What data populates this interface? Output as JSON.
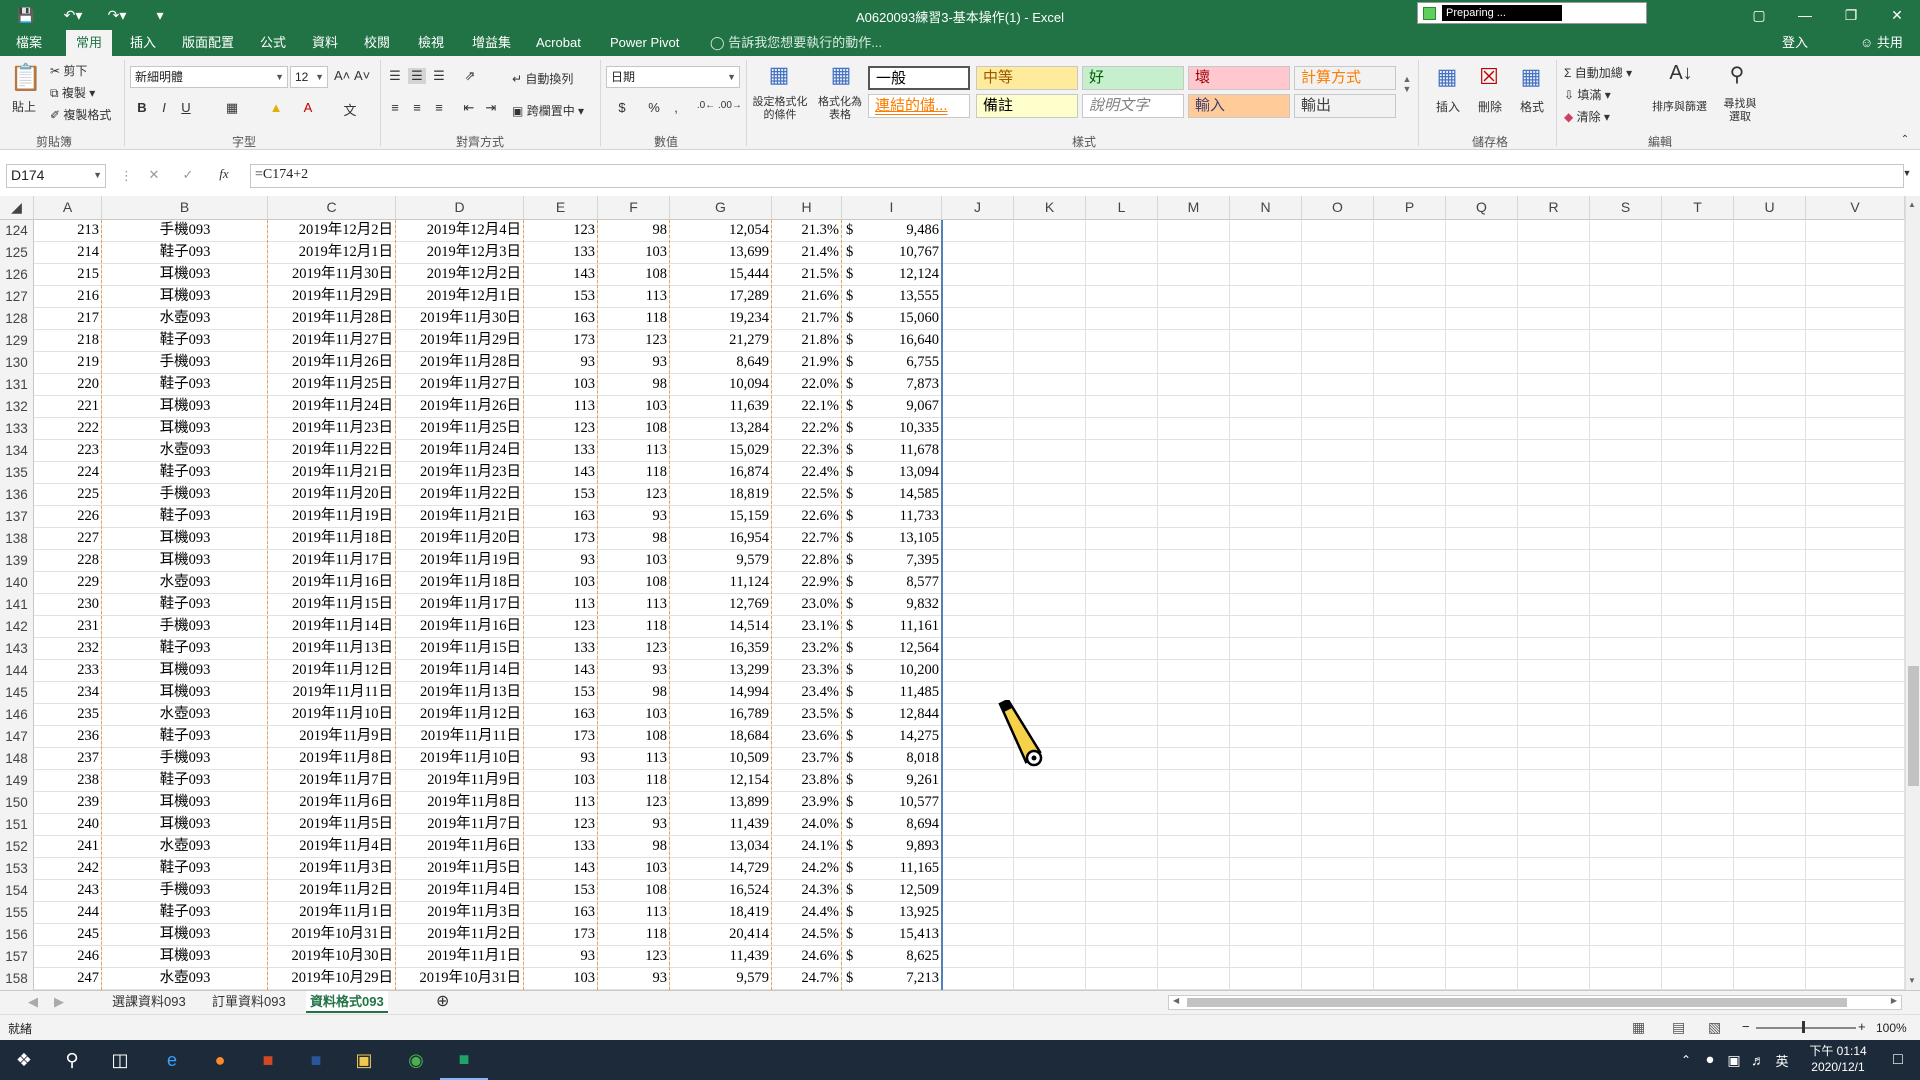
{
  "window": {
    "title": "A0620093練習3-基本操作(1) - Excel",
    "preparing_text": "Preparing ...",
    "signin": "登入",
    "share": "共用"
  },
  "menu": {
    "tabs": [
      "檔案",
      "常用",
      "插入",
      "版面配置",
      "公式",
      "資料",
      "校閱",
      "檢視",
      "增益集",
      "Acrobat",
      "Power Pivot"
    ],
    "active_index": 1,
    "tellme": "告訴我您想要執行的動作..."
  },
  "ribbon": {
    "clipboard": {
      "paste": "貼上",
      "cut": "剪下",
      "copy": "複製",
      "format_painter": "複製格式",
      "label": "剪貼簿"
    },
    "font": {
      "name": "新細明體",
      "size": "12",
      "label": "字型",
      "bold": "B",
      "italic": "I",
      "underline": "U"
    },
    "alignment": {
      "wrap": "自動換列",
      "merge": "跨欄置中",
      "label": "對齊方式"
    },
    "number": {
      "format": "日期",
      "currency": "$",
      "percent": "%",
      "comma": ",",
      "label": "數值"
    },
    "styles": {
      "conditional": "設定格式化的條件",
      "as_table": "格式化為表格",
      "cells": [
        {
          "text": "一般",
          "bg": "#ffffff",
          "fg": "#000000"
        },
        {
          "text": "中等",
          "bg": "#ffeb9c",
          "fg": "#9c5700"
        },
        {
          "text": "好",
          "bg": "#c6efce",
          "fg": "#006100"
        },
        {
          "text": "壞",
          "bg": "#ffc7ce",
          "fg": "#9c0006"
        },
        {
          "text": "計算方式",
          "bg": "#f2f2f2",
          "fg": "#fa7d00"
        },
        {
          "text": "連結的儲...",
          "bg": "#ffffff",
          "fg": "#fa7d00"
        },
        {
          "text": "備註",
          "bg": "#ffffcc",
          "fg": "#000000"
        },
        {
          "text": "說明文字",
          "bg": "#ffffff",
          "fg": "#7f7f7f"
        },
        {
          "text": "輸入",
          "bg": "#ffcc99",
          "fg": "#3f3f76"
        },
        {
          "text": "輸出",
          "bg": "#f2f2f2",
          "fg": "#3f3f3f"
        }
      ],
      "label": "樣式"
    },
    "cells_grp": {
      "insert": "插入",
      "delete": "刪除",
      "format": "格式",
      "label": "儲存格"
    },
    "editing": {
      "autosum": "自動加總",
      "fill": "填滿",
      "clear": "清除",
      "sort": "排序與篩選",
      "find": "尋找與選取",
      "label": "編輯"
    }
  },
  "formula_bar": {
    "name_box": "D174",
    "formula": "=C174+2",
    "fx": "fx"
  },
  "columns": [
    "A",
    "B",
    "C",
    "D",
    "E",
    "F",
    "G",
    "H",
    "I",
    "J",
    "K",
    "L",
    "M",
    "N",
    "O",
    "P",
    "Q",
    "R",
    "S",
    "T",
    "U",
    "V"
  ],
  "rows": [
    {
      "n": "124",
      "a": "213",
      "b": "手機093",
      "c": "2019年12月2日",
      "d": "2019年12月4日",
      "e": "123",
      "f": "98",
      "g": "12,054",
      "h": "21.3%",
      "i": "9,486"
    },
    {
      "n": "125",
      "a": "214",
      "b": "鞋子093",
      "c": "2019年12月1日",
      "d": "2019年12月3日",
      "e": "133",
      "f": "103",
      "g": "13,699",
      "h": "21.4%",
      "i": "10,767"
    },
    {
      "n": "126",
      "a": "215",
      "b": "耳機093",
      "c": "2019年11月30日",
      "d": "2019年12月2日",
      "e": "143",
      "f": "108",
      "g": "15,444",
      "h": "21.5%",
      "i": "12,124"
    },
    {
      "n": "127",
      "a": "216",
      "b": "耳機093",
      "c": "2019年11月29日",
      "d": "2019年12月1日",
      "e": "153",
      "f": "113",
      "g": "17,289",
      "h": "21.6%",
      "i": "13,555"
    },
    {
      "n": "128",
      "a": "217",
      "b": "水壺093",
      "c": "2019年11月28日",
      "d": "2019年11月30日",
      "e": "163",
      "f": "118",
      "g": "19,234",
      "h": "21.7%",
      "i": "15,060"
    },
    {
      "n": "129",
      "a": "218",
      "b": "鞋子093",
      "c": "2019年11月27日",
      "d": "2019年11月29日",
      "e": "173",
      "f": "123",
      "g": "21,279",
      "h": "21.8%",
      "i": "16,640"
    },
    {
      "n": "130",
      "a": "219",
      "b": "手機093",
      "c": "2019年11月26日",
      "d": "2019年11月28日",
      "e": "93",
      "f": "93",
      "g": "8,649",
      "h": "21.9%",
      "i": "6,755"
    },
    {
      "n": "131",
      "a": "220",
      "b": "鞋子093",
      "c": "2019年11月25日",
      "d": "2019年11月27日",
      "e": "103",
      "f": "98",
      "g": "10,094",
      "h": "22.0%",
      "i": "7,873"
    },
    {
      "n": "132",
      "a": "221",
      "b": "耳機093",
      "c": "2019年11月24日",
      "d": "2019年11月26日",
      "e": "113",
      "f": "103",
      "g": "11,639",
      "h": "22.1%",
      "i": "9,067"
    },
    {
      "n": "133",
      "a": "222",
      "b": "耳機093",
      "c": "2019年11月23日",
      "d": "2019年11月25日",
      "e": "123",
      "f": "108",
      "g": "13,284",
      "h": "22.2%",
      "i": "10,335"
    },
    {
      "n": "134",
      "a": "223",
      "b": "水壺093",
      "c": "2019年11月22日",
      "d": "2019年11月24日",
      "e": "133",
      "f": "113",
      "g": "15,029",
      "h": "22.3%",
      "i": "11,678"
    },
    {
      "n": "135",
      "a": "224",
      "b": "鞋子093",
      "c": "2019年11月21日",
      "d": "2019年11月23日",
      "e": "143",
      "f": "118",
      "g": "16,874",
      "h": "22.4%",
      "i": "13,094"
    },
    {
      "n": "136",
      "a": "225",
      "b": "手機093",
      "c": "2019年11月20日",
      "d": "2019年11月22日",
      "e": "153",
      "f": "123",
      "g": "18,819",
      "h": "22.5%",
      "i": "14,585"
    },
    {
      "n": "137",
      "a": "226",
      "b": "鞋子093",
      "c": "2019年11月19日",
      "d": "2019年11月21日",
      "e": "163",
      "f": "93",
      "g": "15,159",
      "h": "22.6%",
      "i": "11,733"
    },
    {
      "n": "138",
      "a": "227",
      "b": "耳機093",
      "c": "2019年11月18日",
      "d": "2019年11月20日",
      "e": "173",
      "f": "98",
      "g": "16,954",
      "h": "22.7%",
      "i": "13,105"
    },
    {
      "n": "139",
      "a": "228",
      "b": "耳機093",
      "c": "2019年11月17日",
      "d": "2019年11月19日",
      "e": "93",
      "f": "103",
      "g": "9,579",
      "h": "22.8%",
      "i": "7,395"
    },
    {
      "n": "140",
      "a": "229",
      "b": "水壺093",
      "c": "2019年11月16日",
      "d": "2019年11月18日",
      "e": "103",
      "f": "108",
      "g": "11,124",
      "h": "22.9%",
      "i": "8,577"
    },
    {
      "n": "141",
      "a": "230",
      "b": "鞋子093",
      "c": "2019年11月15日",
      "d": "2019年11月17日",
      "e": "113",
      "f": "113",
      "g": "12,769",
      "h": "23.0%",
      "i": "9,832"
    },
    {
      "n": "142",
      "a": "231",
      "b": "手機093",
      "c": "2019年11月14日",
      "d": "2019年11月16日",
      "e": "123",
      "f": "118",
      "g": "14,514",
      "h": "23.1%",
      "i": "11,161"
    },
    {
      "n": "143",
      "a": "232",
      "b": "鞋子093",
      "c": "2019年11月13日",
      "d": "2019年11月15日",
      "e": "133",
      "f": "123",
      "g": "16,359",
      "h": "23.2%",
      "i": "12,564"
    },
    {
      "n": "144",
      "a": "233",
      "b": "耳機093",
      "c": "2019年11月12日",
      "d": "2019年11月14日",
      "e": "143",
      "f": "93",
      "g": "13,299",
      "h": "23.3%",
      "i": "10,200"
    },
    {
      "n": "145",
      "a": "234",
      "b": "耳機093",
      "c": "2019年11月11日",
      "d": "2019年11月13日",
      "e": "153",
      "f": "98",
      "g": "14,994",
      "h": "23.4%",
      "i": "11,485"
    },
    {
      "n": "146",
      "a": "235",
      "b": "水壺093",
      "c": "2019年11月10日",
      "d": "2019年11月12日",
      "e": "163",
      "f": "103",
      "g": "16,789",
      "h": "23.5%",
      "i": "12,844"
    },
    {
      "n": "147",
      "a": "236",
      "b": "鞋子093",
      "c": "2019年11月9日",
      "d": "2019年11月11日",
      "e": "173",
      "f": "108",
      "g": "18,684",
      "h": "23.6%",
      "i": "14,275"
    },
    {
      "n": "148",
      "a": "237",
      "b": "手機093",
      "c": "2019年11月8日",
      "d": "2019年11月10日",
      "e": "93",
      "f": "113",
      "g": "10,509",
      "h": "23.7%",
      "i": "8,018"
    },
    {
      "n": "149",
      "a": "238",
      "b": "鞋子093",
      "c": "2019年11月7日",
      "d": "2019年11月9日",
      "e": "103",
      "f": "118",
      "g": "12,154",
      "h": "23.8%",
      "i": "9,261"
    },
    {
      "n": "150",
      "a": "239",
      "b": "耳機093",
      "c": "2019年11月6日",
      "d": "2019年11月8日",
      "e": "113",
      "f": "123",
      "g": "13,899",
      "h": "23.9%",
      "i": "10,577"
    },
    {
      "n": "151",
      "a": "240",
      "b": "耳機093",
      "c": "2019年11月5日",
      "d": "2019年11月7日",
      "e": "123",
      "f": "93",
      "g": "11,439",
      "h": "24.0%",
      "i": "8,694"
    },
    {
      "n": "152",
      "a": "241",
      "b": "水壺093",
      "c": "2019年11月4日",
      "d": "2019年11月6日",
      "e": "133",
      "f": "98",
      "g": "13,034",
      "h": "24.1%",
      "i": "9,893"
    },
    {
      "n": "153",
      "a": "242",
      "b": "鞋子093",
      "c": "2019年11月3日",
      "d": "2019年11月5日",
      "e": "143",
      "f": "103",
      "g": "14,729",
      "h": "24.2%",
      "i": "11,165"
    },
    {
      "n": "154",
      "a": "243",
      "b": "手機093",
      "c": "2019年11月2日",
      "d": "2019年11月4日",
      "e": "153",
      "f": "108",
      "g": "16,524",
      "h": "24.3%",
      "i": "12,509"
    },
    {
      "n": "155",
      "a": "244",
      "b": "鞋子093",
      "c": "2019年11月1日",
      "d": "2019年11月3日",
      "e": "163",
      "f": "113",
      "g": "18,419",
      "h": "24.4%",
      "i": "13,925"
    },
    {
      "n": "156",
      "a": "245",
      "b": "耳機093",
      "c": "2019年10月31日",
      "d": "2019年11月2日",
      "e": "173",
      "f": "118",
      "g": "20,414",
      "h": "24.5%",
      "i": "15,413"
    },
    {
      "n": "157",
      "a": "246",
      "b": "耳機093",
      "c": "2019年10月30日",
      "d": "2019年11月1日",
      "e": "93",
      "f": "123",
      "g": "11,439",
      "h": "24.6%",
      "i": "8,625"
    },
    {
      "n": "158",
      "a": "247",
      "b": "水壺093",
      "c": "2019年10月29日",
      "d": "2019年10月31日",
      "e": "103",
      "f": "93",
      "g": "9,579",
      "h": "24.7%",
      "i": "7,213"
    }
  ],
  "currency_symbol": "$",
  "sheets": [
    "選課資料093",
    "訂單資料093",
    "資料格式093"
  ],
  "active_sheet": 2,
  "status": {
    "ready": "就緒",
    "zoom": "100%"
  },
  "taskbar": {
    "time": "下午 01:14",
    "date": "2020/12/1",
    "ime": "英"
  },
  "colors": {
    "excel_green": "#217346",
    "selection_border": "#217346",
    "range_border_orange": "#f0a050",
    "range_border_blue": "#4f81bd"
  }
}
